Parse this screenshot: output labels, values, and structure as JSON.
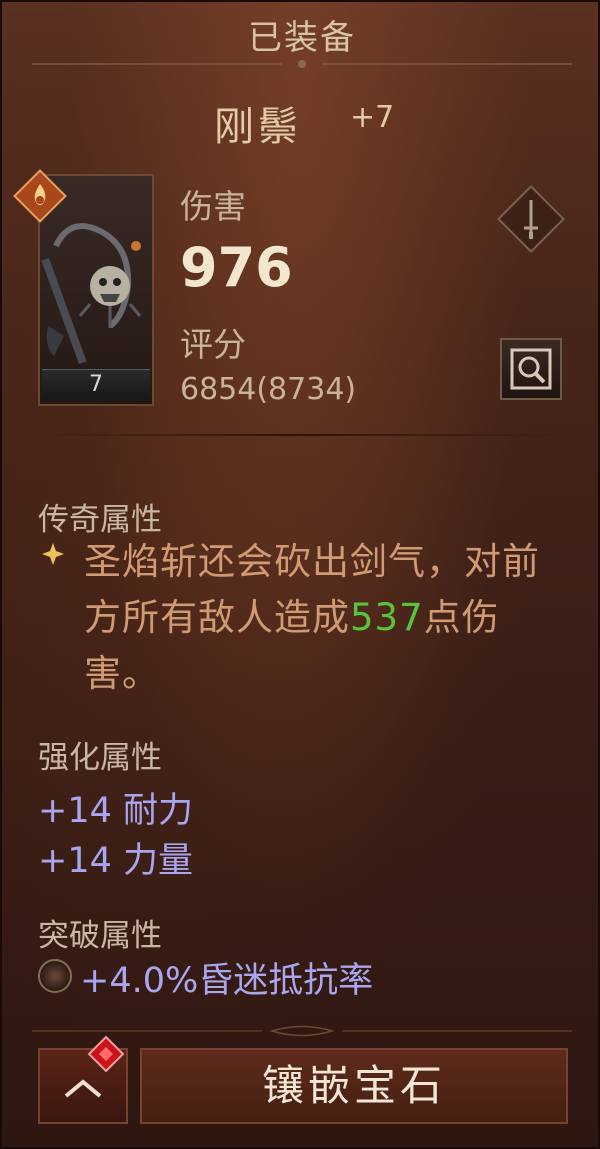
{
  "panel": {
    "title": "已装备"
  },
  "item": {
    "name": "刚鬃",
    "plus": "+7",
    "level": "7"
  },
  "stats": {
    "damage_label": "伤害",
    "damage_value": "976",
    "score_label": "评分",
    "score_value": "6854(8734)"
  },
  "legendary": {
    "header": "传奇属性",
    "text_before": "圣焰斩还会砍出剑气，对前方所有敌人造成",
    "number": "537",
    "text_after": "点伤害。"
  },
  "enhance": {
    "header": "强化属性",
    "lines": [
      "+14 耐力",
      "+14 力量"
    ]
  },
  "breakthrough": {
    "header": "突破属性",
    "line": "+4.0%昏迷抵抗率"
  },
  "actions": {
    "socket_label": "镶嵌宝石"
  },
  "colors": {
    "legend_text": "#d09a72",
    "legend_number": "#58c43c",
    "enhance_text": "#a9a6f0",
    "title_text": "#d8c2a8"
  },
  "icons": {
    "class_badge": "fire-badge-icon",
    "weapon_type": "sword-icon",
    "inspect": "magnifier-icon",
    "legend_marker": "diamond-icon",
    "breakthrough": "stun-icon",
    "collapse": "chevron-up-icon",
    "gem": "red-gem-icon"
  }
}
